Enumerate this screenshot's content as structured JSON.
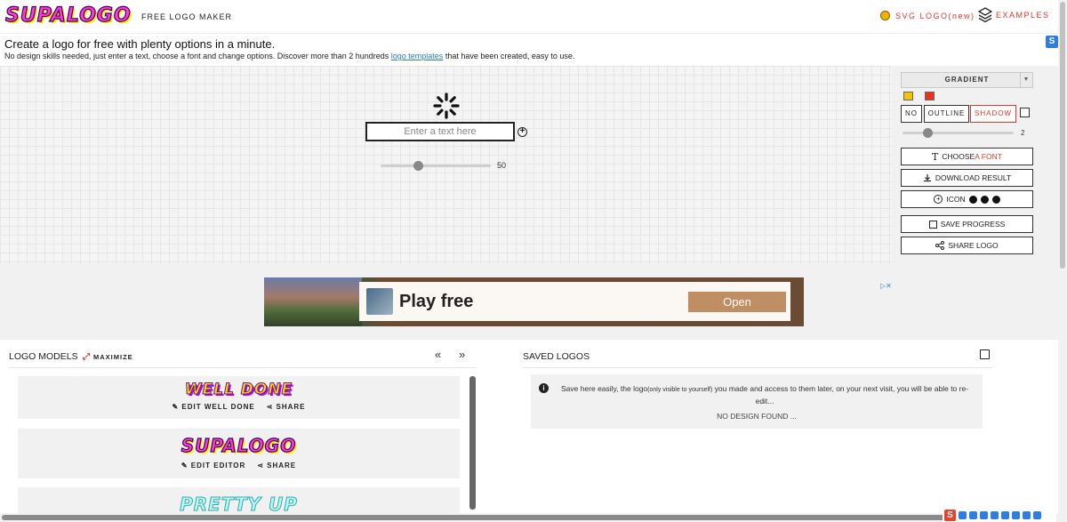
{
  "header": {
    "brand": "SUPALOGO",
    "subtitle": "FREE LOGO MAKER",
    "nav_svg": "SVG LOGO(new)",
    "nav_examples": "EXAMPLES"
  },
  "intro": {
    "title": "Create a logo for free with plenty options in a minute.",
    "desc_before": "No design skills needed, just enter a text, choose a font and change options. Discover more than 2 hundreds ",
    "desc_link": "logo templates",
    "desc_after": " that have been created, easy to use."
  },
  "editor": {
    "text_placeholder": "Enter a text here",
    "size_value": "50",
    "size_fraction": 0.34
  },
  "panel": {
    "fill_mode": "GRADIENT",
    "colors": [
      "#f5c400",
      "#e8341c"
    ],
    "effects": {
      "no": "NO",
      "outline": "OUTLINE",
      "shadow": "SHADOW"
    },
    "outline_value": "2",
    "outline_fraction": 0.22,
    "choose_font_a": "CHOOSE ",
    "choose_font_b": "A FONT",
    "download": "DOWNLOAD RESULT",
    "icon": "ICON",
    "save_progress": "SAVE PROGRESS",
    "share_logo": "SHARE LOGO"
  },
  "ad": {
    "headline": "Play free",
    "cta": "Open"
  },
  "models": {
    "title": "LOGO MODELS",
    "maximize": "MAXIMIZE",
    "prev": "«",
    "next": "»",
    "items": [
      {
        "logo": "WELL DONE",
        "edit": "EDIT WELL DONE",
        "share": "SHARE"
      },
      {
        "logo": "SUPALOGO",
        "edit": "EDIT EDITOR",
        "share": "SHARE"
      },
      {
        "logo": "PRETTY UP"
      }
    ]
  },
  "saved": {
    "title": "SAVED LOGOS",
    "text_a": "Save here easily, the logo",
    "text_small": "(only visible to yourself)",
    "text_b": " you made and access to them later, on your next visit, you will be able to re-edit...",
    "empty": "NO DESIGN FOUND ..."
  }
}
